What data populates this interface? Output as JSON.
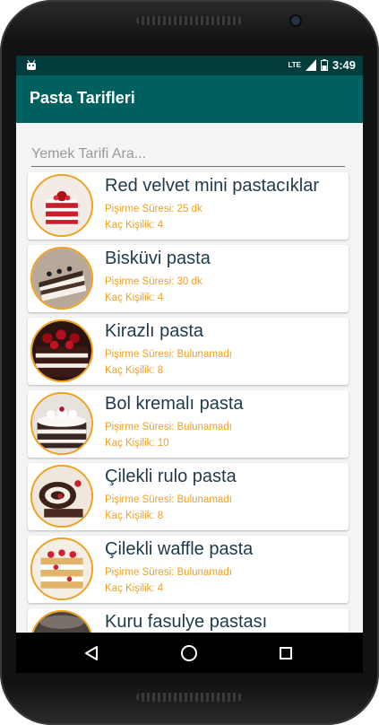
{
  "status": {
    "network": "LTE",
    "time": "3:49"
  },
  "app": {
    "title": "Pasta Tarifleri"
  },
  "search": {
    "placeholder": "Yemek Tarifi Ara..."
  },
  "recipes": [
    {
      "name": "Red velvet mini pastacıklar",
      "time": "Pişirme Süresi: 25 dk",
      "servings": "Kaç Kişilik: 4"
    },
    {
      "name": "Bisküvi pasta",
      "time": "Pişirme Süresi: 30 dk",
      "servings": "Kaç Kişilik: 4"
    },
    {
      "name": "Kirazlı pasta",
      "time": "Pişirme Süresi: Bulunamadı",
      "servings": "Kaç Kişilik: 8"
    },
    {
      "name": "Bol kremalı pasta",
      "time": "Pişirme Süresi: Bulunamadı",
      "servings": "Kaç Kişilik: 10"
    },
    {
      "name": "Çilekli rulo pasta",
      "time": "Pişirme Süresi: Bulunamadı",
      "servings": "Kaç Kişilik: 8"
    },
    {
      "name": "Çilekli waffle pasta",
      "time": "Pişirme Süresi: Bulunamadı",
      "servings": "Kaç Kişilik: 4"
    },
    {
      "name": "Kuru fasulye pastası",
      "time": "",
      "servings": ""
    }
  ],
  "colors": {
    "primary": "#00605f",
    "primary_dark": "#003d3c",
    "accent": "#f0a020",
    "title_text": "#1f3a4a"
  },
  "icons": {
    "back": "back-triangle-icon",
    "home": "home-circle-icon",
    "recents": "recents-square-icon"
  }
}
